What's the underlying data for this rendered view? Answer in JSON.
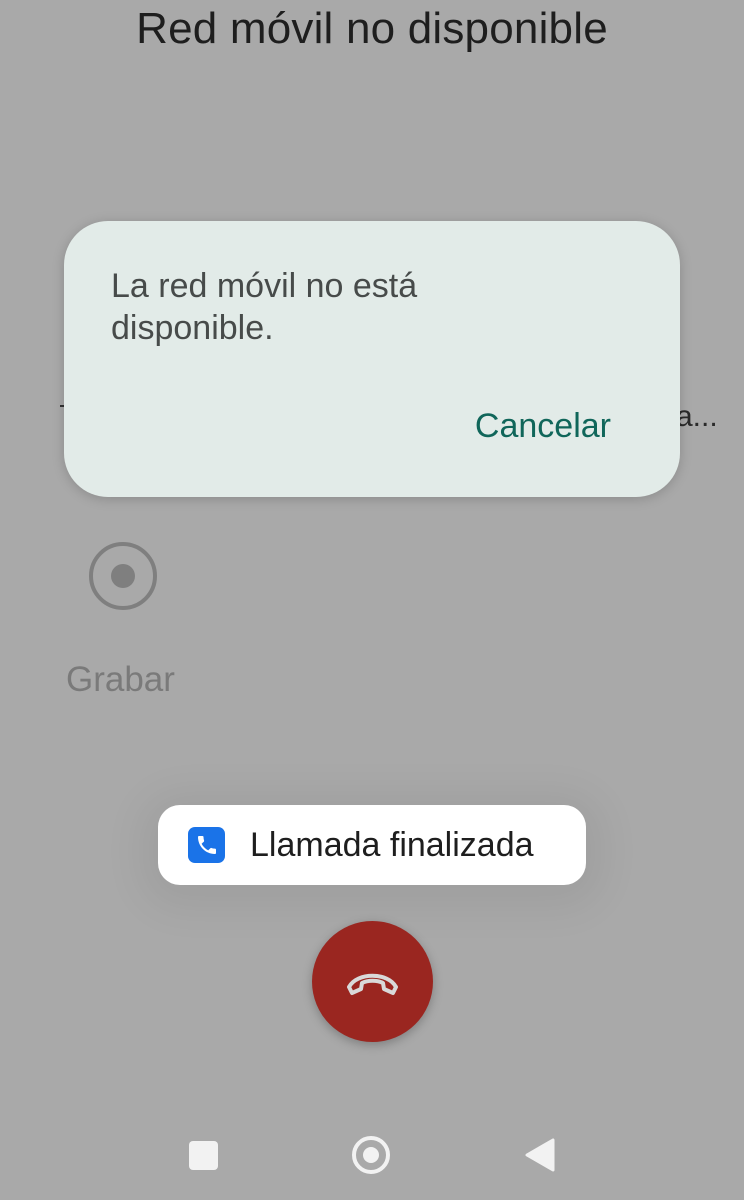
{
  "screen": {
    "title": "Red móvil no disponible",
    "background_color": "#a9a9a9"
  },
  "background": {
    "dash_text": "-",
    "truncated_text": "a...",
    "record": {
      "label": "Grabar",
      "icon": "record-icon"
    }
  },
  "dialog": {
    "message": "La red móvil no está disponible.",
    "cancel_label": "Cancelar",
    "background_color": "#e2ebe8",
    "accent_color": "#10665a"
  },
  "toast": {
    "text": "Llamada finalizada",
    "icon": "phone-app-icon",
    "icon_color": "#1a73e8"
  },
  "end_call": {
    "icon": "hang-up-icon",
    "color": "#9a2620"
  },
  "nav_bar": {
    "items": [
      {
        "name": "recents",
        "icon": "square-icon"
      },
      {
        "name": "home",
        "icon": "home-circle-icon"
      },
      {
        "name": "back",
        "icon": "back-triangle-icon"
      }
    ]
  }
}
